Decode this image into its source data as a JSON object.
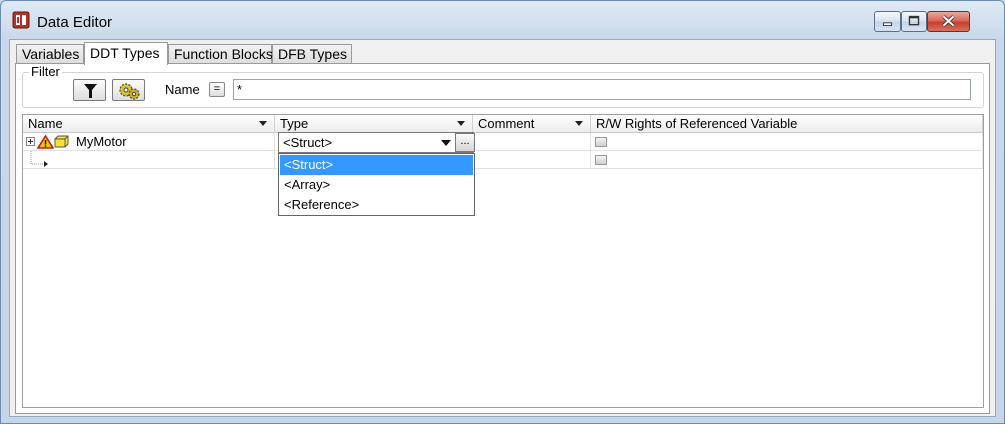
{
  "window": {
    "title": "Data Editor"
  },
  "tabs": [
    {
      "label": "Variables"
    },
    {
      "label": "DDT Types"
    },
    {
      "label": "Function Blocks"
    },
    {
      "label": "DFB Types"
    }
  ],
  "active_tab": "DDT Types",
  "filter": {
    "legend": "Filter",
    "name_label": "Name",
    "eq_label": "=",
    "name_value": "*"
  },
  "grid": {
    "columns": [
      {
        "label": "Name"
      },
      {
        "label": "Type"
      },
      {
        "label": "Comment"
      },
      {
        "label": "R/W Rights of Referenced Variable"
      }
    ],
    "rows": [
      {
        "name": "MyMotor",
        "type": "<Struct>",
        "comment": ""
      }
    ]
  },
  "type_combo": {
    "value": "<Struct>",
    "ellipsis_label": "...",
    "options": [
      {
        "label": "<Struct>",
        "selected": true
      },
      {
        "label": "<Array>",
        "selected": false
      },
      {
        "label": "<Reference>",
        "selected": false
      }
    ]
  },
  "colors": {
    "selection": "#3399ff",
    "close_button": "#c7402c",
    "title_bar": "#c8d8ea"
  },
  "icons": [
    "app-icon",
    "filter-funnel-icon",
    "gear-icon",
    "expand-plus-icon",
    "warning-icon",
    "ddt-structure-icon",
    "new-row-arrow-icon",
    "dropdown-arrow-icon"
  ]
}
